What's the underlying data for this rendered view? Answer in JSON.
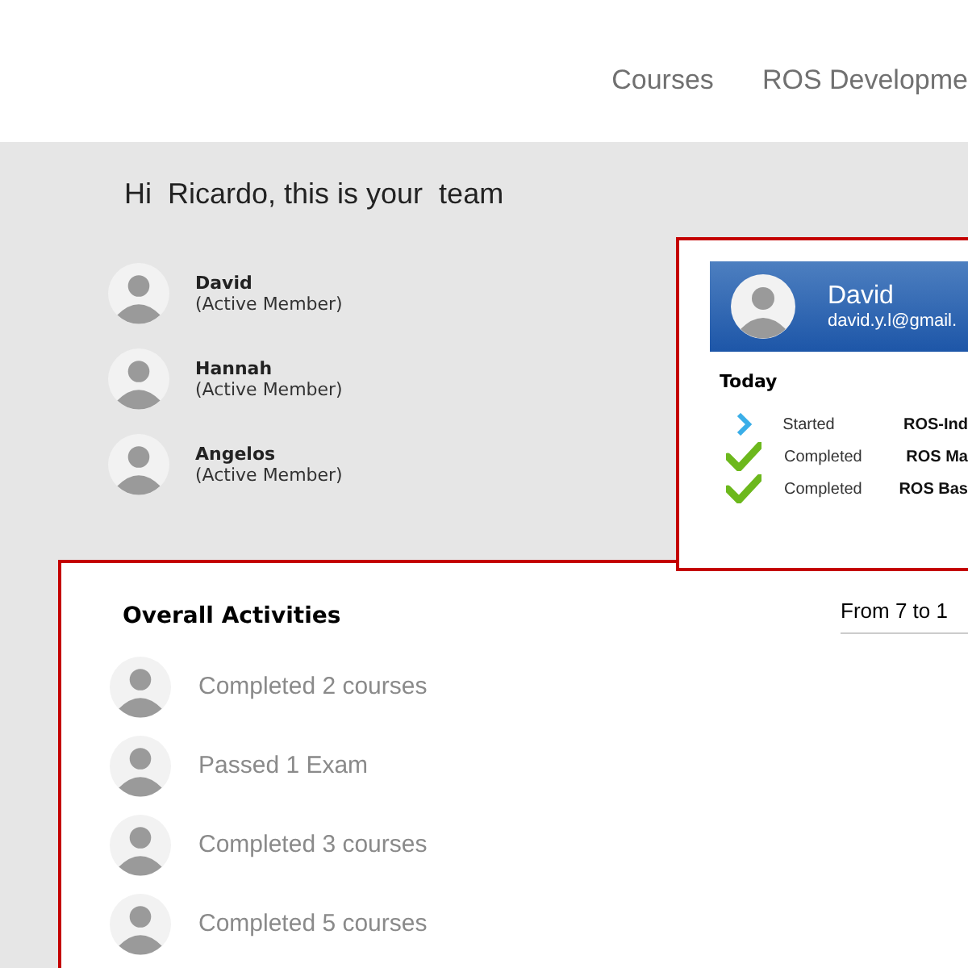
{
  "nav": {
    "items": [
      {
        "label": "Courses"
      },
      {
        "label": "ROS Developme"
      }
    ]
  },
  "greeting": "Hi  Ricardo, this is your  team",
  "team": [
    {
      "name": "David",
      "role": "(Active Member)"
    },
    {
      "name": "Hannah",
      "role": "(Active Member)"
    },
    {
      "name": "Angelos",
      "role": "(Active Member)"
    }
  ],
  "member_card": {
    "name": "David",
    "email": "david.y.l@gmail.",
    "section": "Today",
    "activities": [
      {
        "kind": "started",
        "action": "Started",
        "course": "ROS-Ind"
      },
      {
        "kind": "completed",
        "action": "Completed",
        "course": "ROS Ma"
      },
      {
        "kind": "completed",
        "action": "Completed",
        "course": "ROS Bas"
      }
    ]
  },
  "overall": {
    "title": "Overall Activities",
    "range": "From 7 to 1",
    "items": [
      {
        "text": "Completed 2 courses"
      },
      {
        "text": "Passed 1 Exam"
      },
      {
        "text": "Completed 3 courses"
      },
      {
        "text": "Completed 5 courses"
      }
    ]
  }
}
